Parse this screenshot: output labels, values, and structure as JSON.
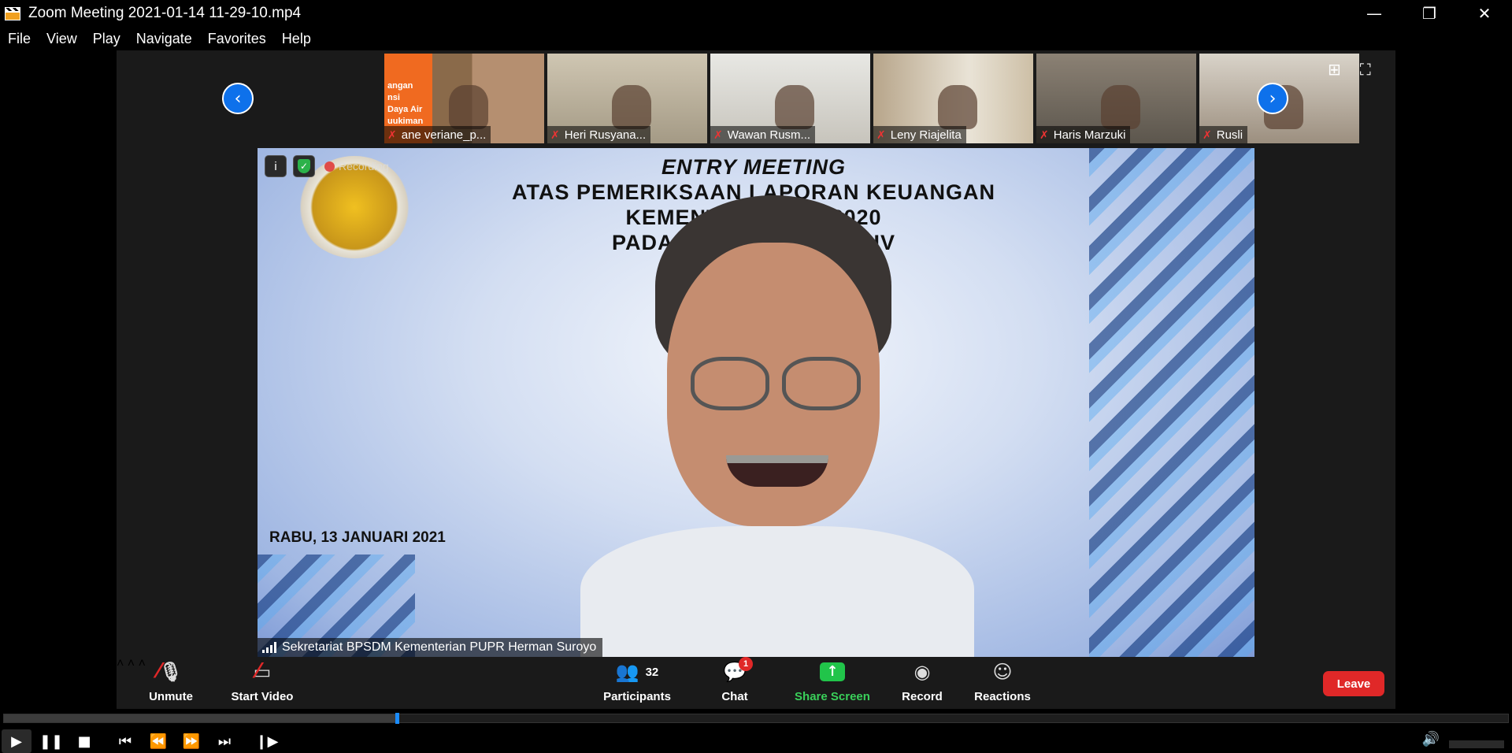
{
  "window": {
    "title": "Zoom Meeting 2021-01-14 11-29-10.mp4",
    "minimize": "—",
    "restore": "❐",
    "close": "✕"
  },
  "menu": [
    "File",
    "View",
    "Play",
    "Navigate",
    "Favorites",
    "Help"
  ],
  "thumbnails": [
    {
      "name": "ane veriane_p...",
      "sign": [
        "angan",
        "nsi",
        "Daya Air",
        "uukiman"
      ]
    },
    {
      "name": "Heri Rusyana..."
    },
    {
      "name": "Wawan Rusm..."
    },
    {
      "name": "Leny Riajelita"
    },
    {
      "name": "Haris Marzuki"
    },
    {
      "name": "Rusli"
    }
  ],
  "icons": {
    "nav_left": "‹",
    "nav_right": "›",
    "gallery": "⊞",
    "fullscreen": "⛶",
    "muted_mic": "🎤",
    "info": "i",
    "shield": "✓"
  },
  "speaker": {
    "headline_1": "ENTRY MEETING",
    "headline_2": "ATAS PEMERIKSAAN LAPORAN KEUANGAN",
    "headline_3": "KEMENTERIAN TA 2020",
    "headline_4": "PADA ENTITAS AN AKN IV",
    "date": "RABU, 13 JANUARI 2021",
    "recording_label": "Recording",
    "name": "Sekretariat BPSDM Kementerian PUPR Herman Suroyo"
  },
  "controls": {
    "unmute": "Unmute",
    "start_video": "Start Video",
    "participants": "Participants",
    "participants_count": "32",
    "chat": "Chat",
    "chat_badge": "1",
    "share_screen": "Share Screen",
    "record": "Record",
    "reactions": "Reactions",
    "leave": "Leave",
    "caret": "˄"
  },
  "player": {
    "progress": 0.26
  },
  "colors": {
    "accent_blue": "#0e71eb",
    "leave_red": "#e02828",
    "share_green": "#21c44a"
  }
}
